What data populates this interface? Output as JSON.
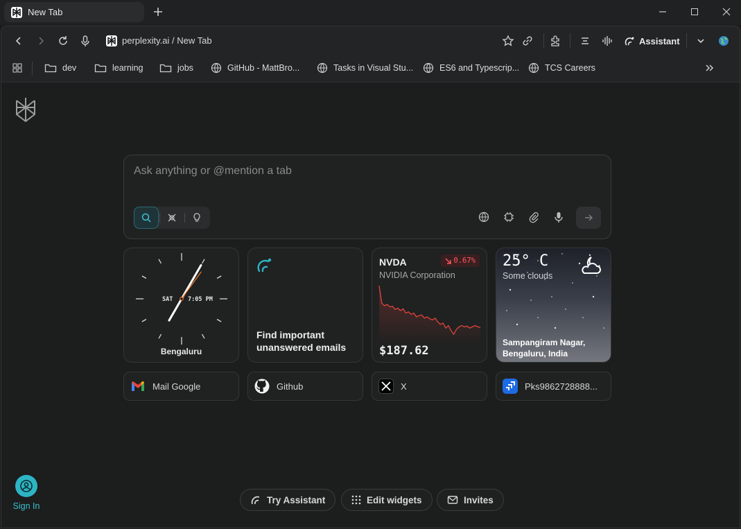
{
  "browser": {
    "tab_title": "New Tab",
    "url": "perplexity.ai / New Tab",
    "assistant_label": "Assistant"
  },
  "bookmarks": [
    {
      "label": "dev",
      "icon": "folder-icon"
    },
    {
      "label": "learning",
      "icon": "folder-icon"
    },
    {
      "label": "jobs",
      "icon": "folder-icon"
    },
    {
      "label": "GitHub - MattBro...",
      "icon": "globe-icon"
    },
    {
      "label": "Tasks in Visual Stu...",
      "icon": "globe-icon"
    },
    {
      "label": "ES6 and Typescrip...",
      "icon": "globe-icon"
    },
    {
      "label": "TCS Careers",
      "icon": "globe-icon"
    }
  ],
  "search": {
    "placeholder": "Ask anything or @mention a tab"
  },
  "widgets": {
    "clock": {
      "day": "SAT",
      "time": "7:05 PM",
      "city": "Bengaluru"
    },
    "assistant_task": {
      "text_line1": "Find important",
      "text_line2": "unanswered emails"
    },
    "stock": {
      "ticker": "NVDA",
      "company": "NVIDIA Corporation",
      "change": "0.67%",
      "price": "$187.62",
      "trend_color": "#e0453c"
    },
    "weather": {
      "temp": "25° C",
      "condition": "Some clouds",
      "location_line1": "Sampangiram Nagar,",
      "location_line2": "Bengaluru, India"
    }
  },
  "shortcuts": [
    {
      "label": "Mail Google",
      "icon": "gmail-icon"
    },
    {
      "label": "Github",
      "icon": "github-icon"
    },
    {
      "label": "X",
      "icon": "x-icon"
    },
    {
      "label": "Pks9862728888...",
      "icon": "jira-icon"
    }
  ],
  "sidebar": {
    "sign_in": "Sign In"
  },
  "footer": {
    "try_assistant": "Try Assistant",
    "edit_widgets": "Edit widgets",
    "invites": "Invites"
  },
  "colors": {
    "accent": "#2db5c4",
    "negative": "#ff5a5f"
  }
}
